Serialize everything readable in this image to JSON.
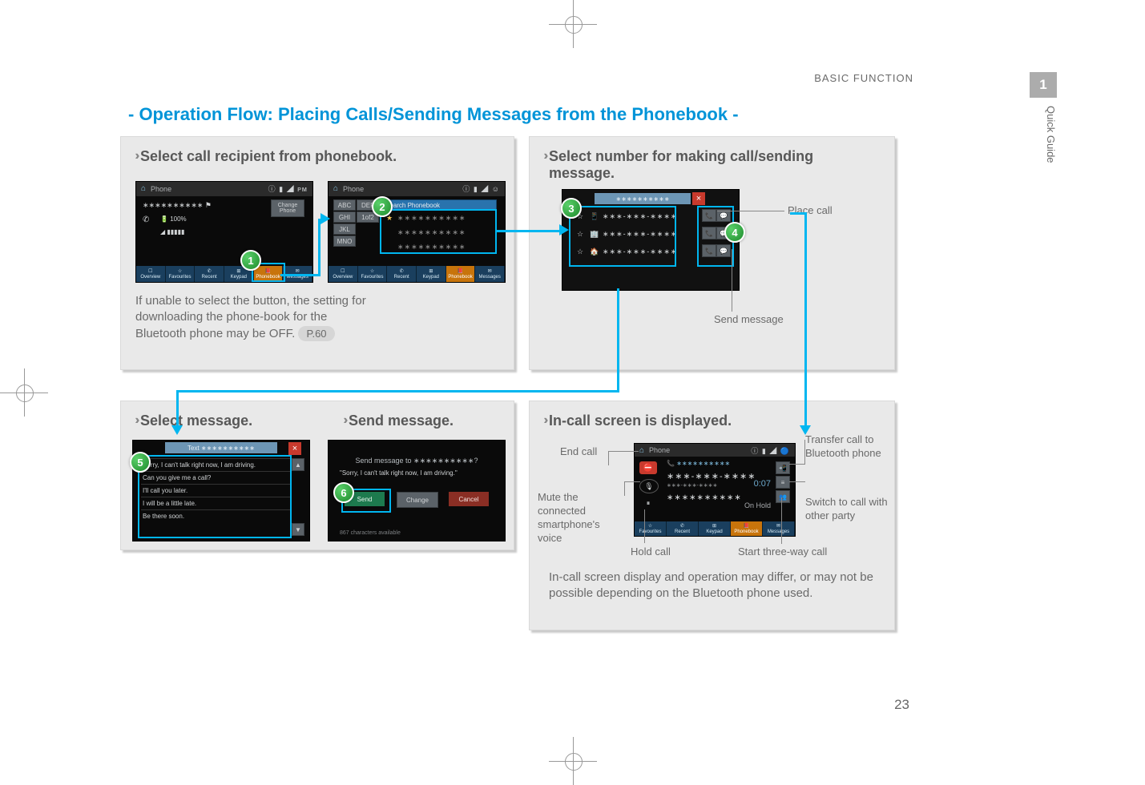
{
  "running_head": "BASIC FUNCTION",
  "page_number": "23",
  "side_tab": {
    "index": "1",
    "label": "Quick Guide"
  },
  "section_title": "- Operation Flow: Placing Calls/Sending Messages from the Phonebook -",
  "panel1": {
    "title": "Select call recipient from phonebook.",
    "note": "If unable to select the button, the setting for downloading the phone-book for the Bluetooth phone may be OFF.",
    "ref": "P.60",
    "shotA": {
      "title": "Phone",
      "indicators": "ⓘ ▮ ◢ ᴘᴍ",
      "name_mask": "∗∗∗∗∗∗∗∗∗∗ ⚑",
      "batt": "100%",
      "signal": "▮▮▮▮▮",
      "tabs": [
        "Overview",
        "Favourites",
        "Recent",
        "Keypad",
        "Phonebook",
        "Messages"
      ],
      "btn_change": "Change Phone"
    },
    "shotB": {
      "title": "Phone",
      "indicators": "ⓘ ▮ ◢ ☺",
      "search": "Search Phonebook",
      "side": [
        "ABC",
        "DEF",
        "GHI",
        "JKL",
        "MNO"
      ],
      "tabs_side": [
        "1of2"
      ],
      "rows": [
        "∗∗∗∗∗∗∗∗∗∗",
        "∗∗∗∗∗∗∗∗∗∗",
        "∗∗∗∗∗∗∗∗∗∗"
      ],
      "star": "★",
      "tabs": [
        "Overview",
        "Favourites",
        "Recent",
        "Keypad",
        "Phonebook",
        "Messages"
      ]
    }
  },
  "panel2": {
    "title": "Select number for making call/sending message.",
    "shot": {
      "header": "∗∗∗∗∗∗∗∗∗∗",
      "rows": [
        {
          "icon": "📱",
          "num": "∗∗∗-∗∗∗-∗∗∗∗"
        },
        {
          "icon": "🏢",
          "num": "∗∗∗-∗∗∗-∗∗∗∗"
        },
        {
          "icon": "🏠",
          "num": "∗∗∗-∗∗∗-∗∗∗∗"
        }
      ]
    },
    "callouts": {
      "call": "Place call",
      "msg": "Send message"
    }
  },
  "panel3": {
    "title": "Select message.",
    "shot": {
      "header": "Text ∗∗∗∗∗∗∗∗∗∗",
      "rows": [
        "Sorry, I can't talk right now, I am driving.",
        "Can you give me a call?",
        "I'll call you later.",
        "I will be a little late.",
        "Be there soon."
      ]
    }
  },
  "panel4": {
    "title": "Send message.",
    "shot": {
      "to": "Send message to ∗∗∗∗∗∗∗∗∗∗?",
      "body": "\"Sorry, I can't talk right now, I am driving.\"",
      "buttons": {
        "send": "Send",
        "change": "Change",
        "cancel": "Cancel"
      },
      "footer": "867 characters available"
    }
  },
  "panel5": {
    "title": "In-call screen is displayed.",
    "shot": {
      "title": "Phone",
      "ind": "ⓘ ▮ ◢ 🔵",
      "name": "∗∗∗∗∗∗∗∗∗∗",
      "num1": "∗∗∗-∗∗∗-∗∗∗∗",
      "time": "0:07",
      "status": "On Hold",
      "name2": "∗∗∗∗∗∗∗∗∗∗",
      "num2": "∗∗∗-∗∗∗-∗∗∗∗",
      "tabs": [
        "Favourites",
        "Recent",
        "Keypad",
        "Phonebook",
        "Messages"
      ],
      "icons": {
        "end": "⛔",
        "mute": "🎙",
        "hold": "⏸"
      }
    },
    "callouts": {
      "end": "End call",
      "mute": "Mute the connected smartphone's voice",
      "hold": "Hold call",
      "three": "Start three-way call",
      "switch": "Switch to call with other party",
      "transfer": "Transfer call to Bluetooth phone"
    },
    "note": "In-call screen display and operation may differ, or may not be possible depending on the Bluetooth phone used."
  }
}
